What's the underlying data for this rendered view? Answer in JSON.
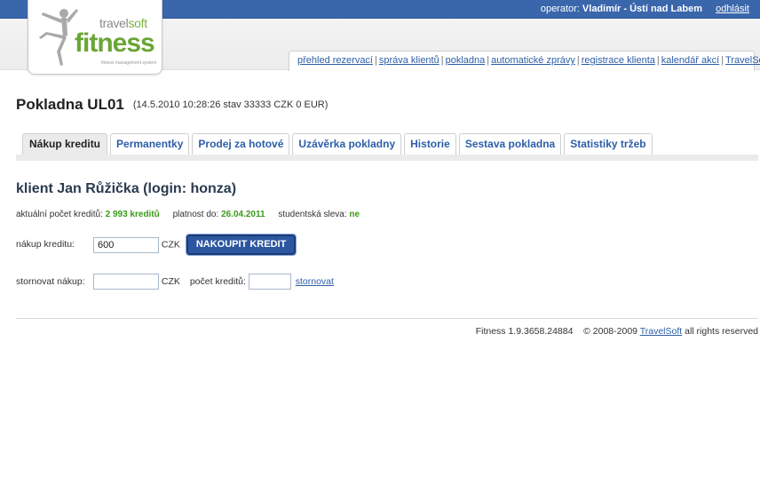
{
  "header": {
    "operator_label": "operator:",
    "operator_name": "Vladimír - Ústí nad Labem",
    "logout": "odhlásit"
  },
  "logo": {
    "brand_prefix": "travel",
    "brand_suffix": "soft",
    "brand_main": "fitness",
    "tagline": "fitness management system"
  },
  "nav": [
    "přehled rezervací",
    "správa klientů",
    "pokladna",
    "automatické zprávy",
    "registrace klienta",
    "kalendář akcí",
    "TravelSoft"
  ],
  "page": {
    "title": "Pokladna UL01",
    "subtitle": "(14.5.2010 10:28:26 stav 33333 CZK 0 EUR)"
  },
  "tabs": [
    "Nákup kreditu",
    "Permanentky",
    "Prodej za hotové",
    "Uzávěrka pokladny",
    "Historie",
    "Sestava pokladna",
    "Statistiky tržeb"
  ],
  "client": {
    "heading": "klient Jan Růžička (login: honza)",
    "credits_label": "aktuální počet kreditů:",
    "credits_value": "2 993 kreditů",
    "valid_label": "platnost do:",
    "valid_value": "26.04.2011",
    "discount_label": "studentská sleva:",
    "discount_value": "ne"
  },
  "purchase": {
    "label": "nákup kreditu:",
    "value": "600",
    "currency": "CZK",
    "button": "NAKOUPIT KREDIT"
  },
  "storno": {
    "label": "stornovat nákup:",
    "value": "",
    "currency": "CZK",
    "count_label": "počet kreditů:",
    "count_value": "",
    "link": "stornovat"
  },
  "footer": {
    "version": "Fitness 1.9.3658.24884",
    "copyright": "© 2008-2009",
    "company": "TravelSoft",
    "rights": "all rights reserved"
  },
  "colors": {
    "topbar": "#3a66ac",
    "link": "#2d5ea8",
    "green_value": "#3a9a1a",
    "button": "#2c57a0"
  }
}
